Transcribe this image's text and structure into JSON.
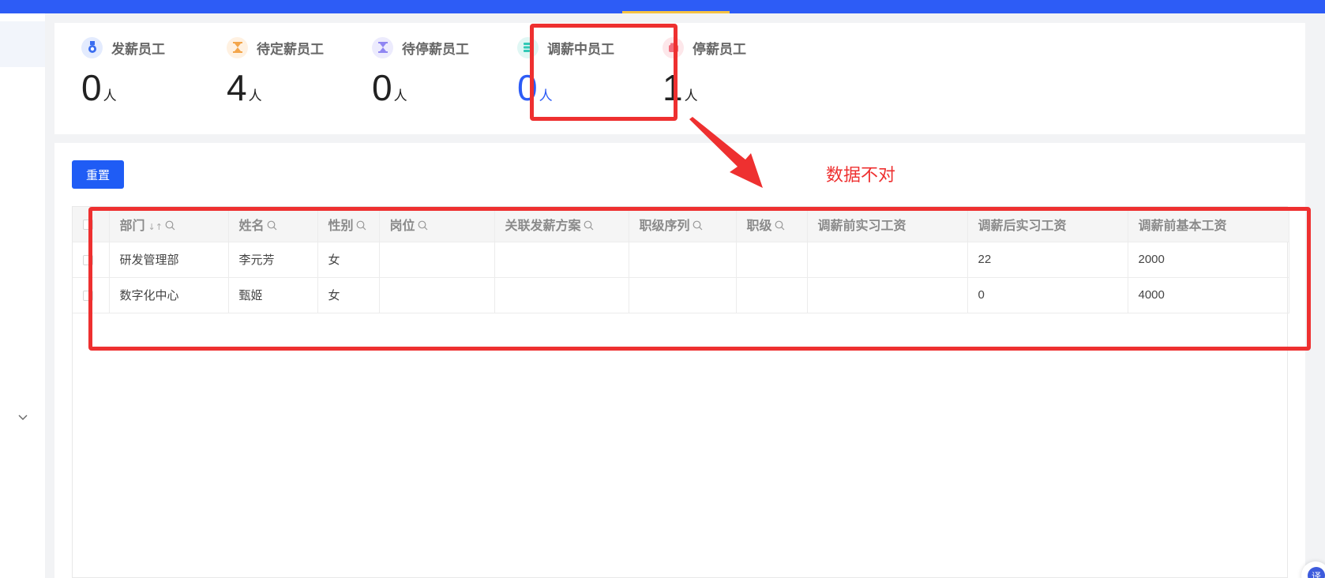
{
  "stats": [
    {
      "label": "发薪员工",
      "value": "0",
      "unit": "人",
      "icon": "medal-icon",
      "color": "#3a6df0",
      "bg": "#e3ebfe"
    },
    {
      "label": "待定薪员工",
      "value": "4",
      "unit": "人",
      "icon": "hourglass-icon",
      "color": "#f3a54a",
      "bg": "#fff1e1"
    },
    {
      "label": "待停薪员工",
      "value": "0",
      "unit": "人",
      "icon": "hourglass-icon",
      "color": "#8f86f2",
      "bg": "#ecebfd"
    },
    {
      "label": "调薪中员工",
      "value": "0",
      "unit": "人",
      "icon": "coins-icon",
      "color": "#31c9b6",
      "bg": "#e0f7f4"
    },
    {
      "label": "停薪员工",
      "value": "1",
      "unit": "人",
      "icon": "wallet-icon",
      "color": "#f0707f",
      "bg": "#fde7ea"
    }
  ],
  "toolbar": {
    "reset_label": "重置"
  },
  "table": {
    "headers": [
      "部门",
      "姓名",
      "性别",
      "岗位",
      "关联发薪方案",
      "职级序列",
      "职级",
      "调薪前实习工资",
      "调薪后实习工资",
      "调薪前基本工资"
    ],
    "sort_glyph": "↓↑",
    "rows": [
      [
        "研发管理部",
        "李元芳",
        "女",
        "",
        "",
        "",
        "",
        "",
        "22",
        "2000"
      ],
      [
        "数字化中心",
        "甄姬",
        "女",
        "",
        "",
        "",
        "",
        "",
        "0",
        "4000"
      ]
    ]
  },
  "annotation": {
    "text": "数据不对",
    "color": "#ee3030"
  },
  "floating": {
    "translate_label": "译"
  }
}
